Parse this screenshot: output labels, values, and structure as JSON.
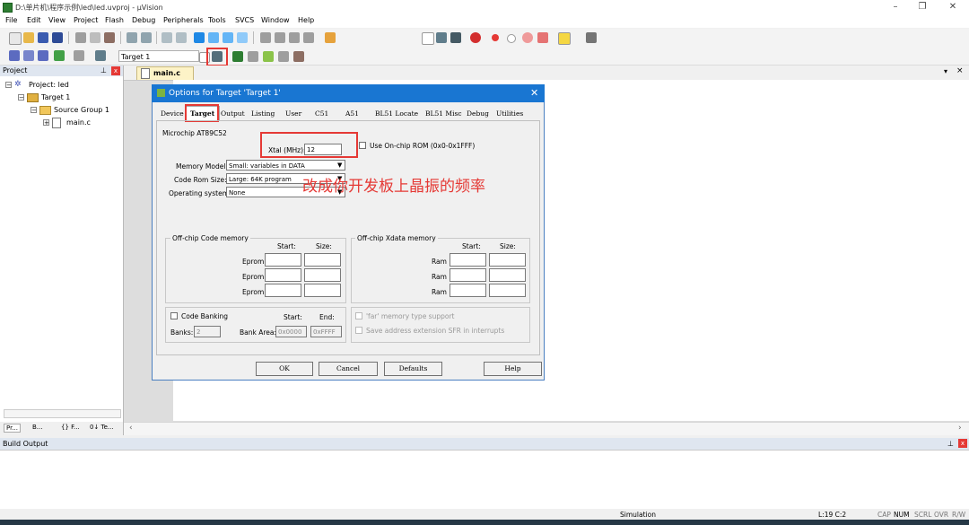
{
  "window": {
    "title": "D:\\单片机\\程序示例\\led\\led.uvproj - µVision",
    "controls": [
      "–",
      "❐",
      "✕"
    ]
  },
  "menu": [
    "File",
    "Edit",
    "View",
    "Project",
    "Flash",
    "Debug",
    "Peripherals",
    "Tools",
    "SVCS",
    "Window",
    "Help"
  ],
  "toolbar": {
    "target_value": "Target 1"
  },
  "project": {
    "header": "Project",
    "root": "Project: led",
    "target": "Target 1",
    "group": "Source Group 1",
    "file": "main.c",
    "bottom_tabs": [
      "Pr...",
      "B...",
      "{} F...",
      "0↓ Te..."
    ]
  },
  "editor": {
    "tab": "main.c"
  },
  "dialog": {
    "title": "Options for Target 'Target 1'",
    "tabs": [
      "Device",
      "Target",
      "Output",
      "Listing",
      "User",
      "C51",
      "A51",
      "BL51 Locate",
      "BL51 Misc",
      "Debug",
      "Utilities"
    ],
    "device_name": "Microchip AT89C52",
    "xtal_label": "Xtal (MHz):",
    "xtal_value": "12",
    "onchip_rom_label": "Use On-chip ROM (0x0-0x1FFF)",
    "memory_model_label": "Memory Model:",
    "memory_model_value": "Small: variables in DATA",
    "code_rom_label": "Code Rom Size:",
    "code_rom_value": "Large: 64K program",
    "os_label": "Operating system:",
    "os_value": "None",
    "offchip_code": {
      "title": "Off-chip Code memory",
      "start": "Start:",
      "size": "Size:",
      "rows": [
        "Eprom",
        "Eprom",
        "Eprom"
      ]
    },
    "offchip_xdata": {
      "title": "Off-chip Xdata memory",
      "start": "Start:",
      "size": "Size:",
      "rows": [
        "Ram",
        "Ram",
        "Ram"
      ]
    },
    "banking": {
      "label": "Code Banking",
      "start": "Start:",
      "end": "End:",
      "banks_label": "Banks:",
      "banks_value": "2",
      "bank_area_label": "Bank Area:",
      "bank_start": "0x0000",
      "bank_end": "0xFFFF"
    },
    "far_label": "'far' memory type support",
    "sfr_label": "Save address extension SFR in interrupts",
    "buttons": [
      "OK",
      "Cancel",
      "Defaults",
      "Help"
    ]
  },
  "annotation": "改成你开发板上晶振的频率",
  "build": {
    "header": "Build Output"
  },
  "status": {
    "mode": "Simulation",
    "position": "L:19 C:2",
    "indicators": [
      "CAP",
      "NUM",
      "SCRL",
      "OVR",
      "R/W"
    ]
  }
}
